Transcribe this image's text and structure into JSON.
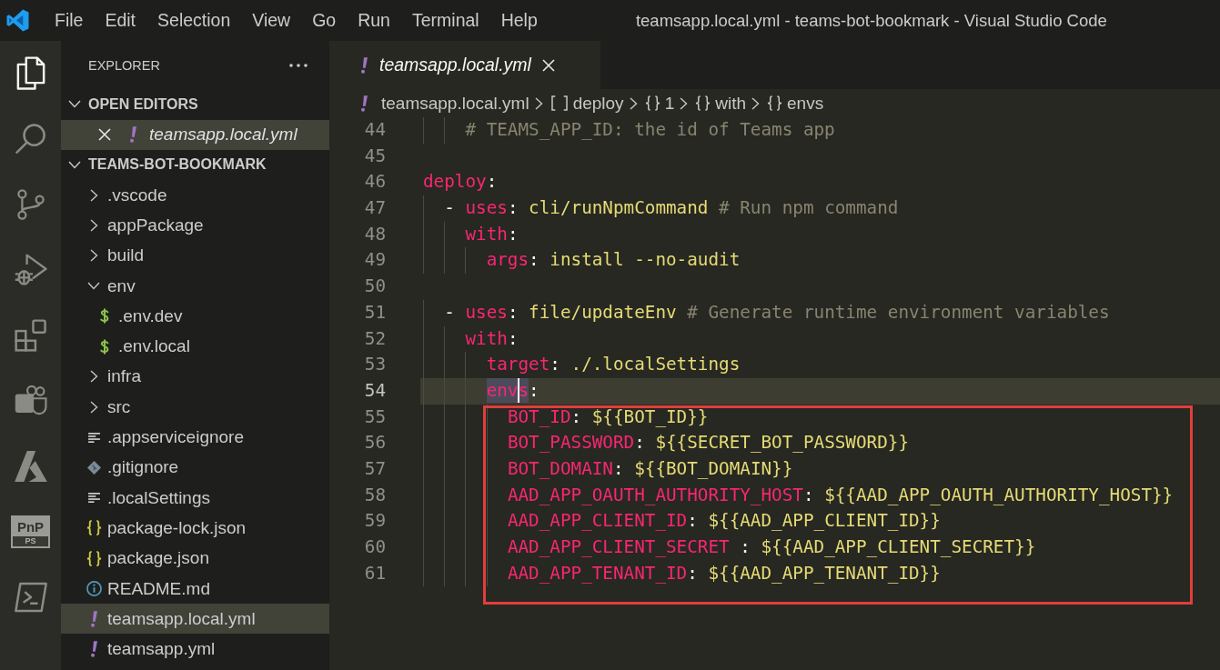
{
  "title_bar": {
    "menu": [
      "File",
      "Edit",
      "Selection",
      "View",
      "Go",
      "Run",
      "Terminal",
      "Help"
    ],
    "title": "teamsapp.local.yml - teams-bot-bookmark - Visual Studio Code"
  },
  "activity_bar": [
    {
      "kind": "explorer",
      "selected": true
    },
    {
      "kind": "search",
      "selected": false
    },
    {
      "kind": "source-control",
      "selected": false
    },
    {
      "kind": "debug",
      "selected": false
    },
    {
      "kind": "extensions",
      "selected": false
    },
    {
      "kind": "teams",
      "selected": false
    },
    {
      "kind": "azure",
      "selected": false
    },
    {
      "kind": "pnp",
      "selected": false,
      "label": "PnP",
      "sublabel": "PS"
    },
    {
      "kind": "terminal",
      "selected": false
    }
  ],
  "sidebar": {
    "title": "EXPLORER",
    "sections": [
      {
        "kind": "open-editors",
        "title": "OPEN EDITORS",
        "expanded": true,
        "items": [
          {
            "label": "teamsapp.local.yml",
            "kind": "yaml",
            "preview": true,
            "selected": true
          }
        ]
      },
      {
        "kind": "folder",
        "title": "TEAMS-BOT-BOOKMARK",
        "expanded": true,
        "items": [
          {
            "label": ".vscode",
            "kind": "folder",
            "expanded": false,
            "selected": false
          },
          {
            "label": "appPackage",
            "kind": "folder",
            "expanded": false,
            "selected": false
          },
          {
            "label": "build",
            "kind": "folder",
            "expanded": false,
            "selected": false
          },
          {
            "label": "env",
            "kind": "folder",
            "expanded": true,
            "selected": false,
            "children": [
              {
                "label": ".env.dev",
                "kind": "dotenv",
                "selected": false
              },
              {
                "label": ".env.local",
                "kind": "dotenv",
                "selected": false
              }
            ]
          },
          {
            "label": "infra",
            "kind": "folder",
            "expanded": false,
            "selected": false
          },
          {
            "label": "src",
            "kind": "folder",
            "expanded": false,
            "selected": false
          },
          {
            "label": ".appserviceignore",
            "kind": "text",
            "selected": false
          },
          {
            "label": ".gitignore",
            "kind": "git",
            "selected": false
          },
          {
            "label": ".localSettings",
            "kind": "text",
            "selected": false
          },
          {
            "label": "package-lock.json",
            "kind": "json",
            "selected": false
          },
          {
            "label": "package.json",
            "kind": "json",
            "selected": false
          },
          {
            "label": "README.md",
            "kind": "info",
            "selected": false
          },
          {
            "label": "teamsapp.local.yml",
            "kind": "yaml",
            "selected": true
          },
          {
            "label": "teamsapp.yml",
            "kind": "yaml",
            "selected": false
          }
        ]
      }
    ]
  },
  "editor": {
    "tabs": [
      {
        "label": "teamsapp.local.yml",
        "kind": "yaml",
        "preview": true,
        "selected": true
      }
    ],
    "breadcrumb": [
      {
        "label": "teamsapp.local.yml",
        "kind": "yaml"
      },
      {
        "label": "deploy",
        "kind": "array"
      },
      {
        "label": "1",
        "kind": "object"
      },
      {
        "label": "with",
        "kind": "object"
      },
      {
        "label": "envs",
        "kind": "object"
      }
    ],
    "line_groups": [
      {
        "framed": false,
        "lines": [
          {
            "number": "44",
            "current": false,
            "tokens": [
              {
                "text": "    # TEAMS_APP_ID: the id of Teams app",
                "kind": "comment"
              }
            ]
          },
          {
            "number": "45",
            "current": false
          },
          {
            "number": "46",
            "current": false,
            "tokens": [
              {
                "text": "deploy",
                "kind": "key"
              },
              {
                "text": ":",
                "kind": "punct"
              }
            ]
          },
          {
            "number": "47",
            "current": false,
            "tokens": [
              {
                "text": "  - ",
                "kind": "punct"
              },
              {
                "text": "uses",
                "kind": "key"
              },
              {
                "text": ": ",
                "kind": "punct"
              },
              {
                "text": "cli/runNpmCommand",
                "kind": "string"
              },
              {
                "text": " # Run npm command",
                "kind": "comment"
              }
            ]
          },
          {
            "number": "48",
            "current": false,
            "tokens": [
              {
                "text": "    with",
                "kind": "key"
              },
              {
                "text": ":",
                "kind": "punct"
              }
            ]
          },
          {
            "number": "49",
            "current": false,
            "tokens": [
              {
                "text": "      args",
                "kind": "key"
              },
              {
                "text": ": ",
                "kind": "punct"
              },
              {
                "text": "install --no-audit",
                "kind": "string"
              }
            ]
          },
          {
            "number": "50",
            "current": false
          },
          {
            "number": "51",
            "current": false,
            "tokens": [
              {
                "text": "  - ",
                "kind": "punct"
              },
              {
                "text": "uses",
                "kind": "key"
              },
              {
                "text": ": ",
                "kind": "punct"
              },
              {
                "text": "file/updateEnv",
                "kind": "string"
              },
              {
                "text": " # Generate runtime environment variables",
                "kind": "comment"
              }
            ]
          },
          {
            "number": "52",
            "current": false,
            "tokens": [
              {
                "text": "    with",
                "kind": "key"
              },
              {
                "text": ":",
                "kind": "punct"
              }
            ]
          },
          {
            "number": "53",
            "current": false,
            "tokens": [
              {
                "text": "      target",
                "kind": "key"
              },
              {
                "text": ": ",
                "kind": "punct"
              },
              {
                "text": "./.localSettings",
                "kind": "string"
              }
            ]
          },
          {
            "number": "54",
            "current": true,
            "tokens": [
              {
                "text": "      env",
                "kind": "match"
              },
              {
                "kind": "cursor"
              },
              {
                "text": "s",
                "kind": "match"
              },
              {
                "text": ":",
                "kind": "punct"
              }
            ]
          }
        ]
      },
      {
        "framed": true,
        "lines": [
          {
            "number": "55",
            "current": false,
            "tokens": [
              {
                "text": "        BOT_ID",
                "kind": "key"
              },
              {
                "text": ": ",
                "kind": "punct"
              },
              {
                "text": "${{BOT_ID}}",
                "kind": "string"
              }
            ]
          },
          {
            "number": "56",
            "current": false,
            "tokens": [
              {
                "text": "        BOT_PASSWORD",
                "kind": "key"
              },
              {
                "text": ": ",
                "kind": "punct"
              },
              {
                "text": "${{SECRET_BOT_PASSWORD}}",
                "kind": "string"
              }
            ]
          },
          {
            "number": "57",
            "current": false,
            "tokens": [
              {
                "text": "        BOT_DOMAIN",
                "kind": "key"
              },
              {
                "text": ": ",
                "kind": "punct"
              },
              {
                "text": "${{BOT_DOMAIN}}",
                "kind": "string"
              }
            ]
          },
          {
            "number": "58",
            "current": false,
            "tokens": [
              {
                "text": "        AAD_APP_OAUTH_AUTHORITY_HOST",
                "kind": "key"
              },
              {
                "text": ": ",
                "kind": "punct"
              },
              {
                "text": "${{AAD_APP_OAUTH_AUTHORITY_HOST}}",
                "kind": "string"
              }
            ]
          },
          {
            "number": "59",
            "current": false,
            "tokens": [
              {
                "text": "        AAD_APP_CLIENT_ID",
                "kind": "key"
              },
              {
                "text": ": ",
                "kind": "punct"
              },
              {
                "text": "${{AAD_APP_CLIENT_ID}}",
                "kind": "string"
              }
            ]
          },
          {
            "number": "60",
            "current": false,
            "tokens": [
              {
                "text": "        AAD_APP_CLIENT_SECRET",
                "kind": "key"
              },
              {
                "text": " : ",
                "kind": "punct"
              },
              {
                "text": "${{AAD_APP_CLIENT_SECRET}}",
                "kind": "string"
              }
            ]
          },
          {
            "number": "61",
            "current": false,
            "tokens": [
              {
                "text": "        AAD_APP_TENANT_ID",
                "kind": "key"
              },
              {
                "text": ": ",
                "kind": "punct"
              },
              {
                "text": "${{AAD_APP_TENANT_ID}}",
                "kind": "string"
              }
            ]
          }
        ]
      }
    ]
  }
}
